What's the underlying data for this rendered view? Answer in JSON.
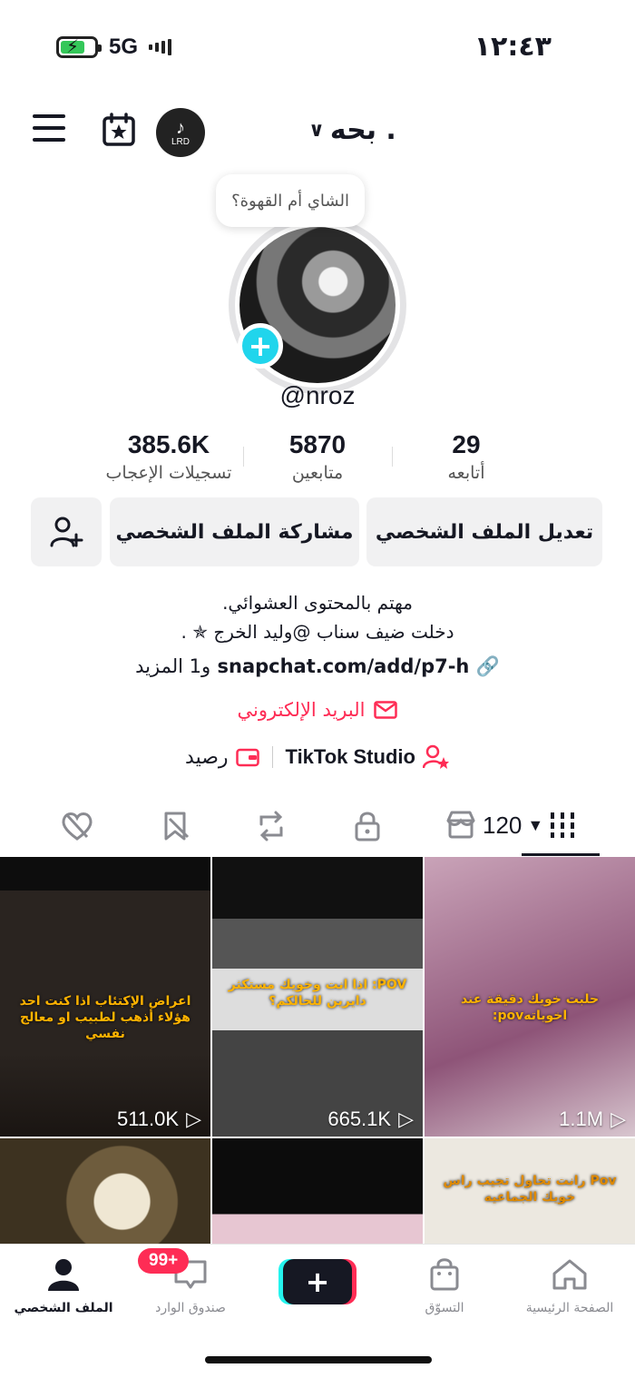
{
  "status_bar": {
    "time": "١٢:٤٣",
    "network": "5G"
  },
  "header": {
    "title": "بحه .",
    "avatar_label": "LRD"
  },
  "profile": {
    "note": "الشاي أم القهوة؟",
    "handle": "@nroz",
    "stats": [
      {
        "value": "29",
        "label": "أتابعه"
      },
      {
        "value": "5870",
        "label": "متابعين"
      },
      {
        "value": "385.6K",
        "label": "تسجيلات الإعجاب"
      }
    ]
  },
  "actions": {
    "edit_label": "تعديل الملف الشخصي",
    "share_label": "مشاركة الملف الشخصي"
  },
  "bio": {
    "line1": "مهتم بالمحتوى العشوائي.",
    "line2": "دخلت ضيف سناب @وليد الخرج ✯ .",
    "link": "snapchat.com/add/p7-h",
    "link_more": "و1 المزيد",
    "email": "البريد الإلكتروني",
    "studio": "TikTok Studio",
    "wallet": "رصيد"
  },
  "tabs": {
    "video_count": "120"
  },
  "videos": [
    {
      "views": "1.1M",
      "caption": "حلبت خويك دقيقة عند اخوياتهpov:",
      "bg": "#b27aa0"
    },
    {
      "views": "665.1K",
      "caption": "POV: اذا انت وخويك مستكثر دايرين للحالكم؟",
      "bg": "#3a3a3a"
    },
    {
      "views": "511.0K",
      "caption": "اعراض الإكتئاب اذا كنت احد هؤلاء أذهب لطبيب او معالج نفسي",
      "bg": "#2b2420"
    },
    {
      "views": "",
      "caption": "Pov رانت تحاول تجيب راس خويك الجماعيه",
      "bg": "#e8e4dc"
    },
    {
      "views": "",
      "caption": "",
      "bg": "#111111"
    },
    {
      "views": "",
      "caption": "",
      "bg": "#6b5a3e"
    }
  ],
  "bottom_nav": {
    "home": "الصفحة الرئيسية",
    "shop": "التسوّق",
    "inbox": "صندوق الوارد",
    "inbox_badge": "99+",
    "profile": "الملف الشخصي"
  }
}
